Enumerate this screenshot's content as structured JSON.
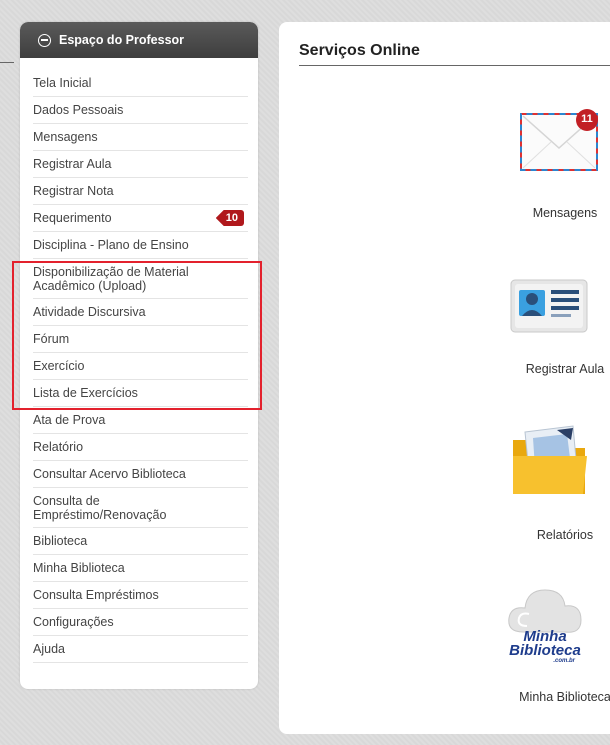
{
  "sidebar": {
    "title": "Espaço do Professor",
    "items": [
      {
        "label": "Tela Inicial"
      },
      {
        "label": "Dados Pessoais"
      },
      {
        "label": "Mensagens"
      },
      {
        "label": "Registrar Aula"
      },
      {
        "label": "Registrar Nota"
      },
      {
        "label": "Requerimento",
        "badge": "10"
      },
      {
        "label": "Disciplina - Plano de Ensino"
      },
      {
        "label": "Disponibilização de Material Acadêmico (Upload)"
      },
      {
        "label": "Atividade Discursiva"
      },
      {
        "label": "Fórum"
      },
      {
        "label": "Exercício"
      },
      {
        "label": "Lista de Exercícios"
      },
      {
        "label": "Ata de Prova"
      },
      {
        "label": "Relatório"
      },
      {
        "label": "Consultar Acervo Biblioteca"
      },
      {
        "label": "Consulta de Empréstimo/Renovação"
      },
      {
        "label": "Biblioteca"
      },
      {
        "label": "Minha Biblioteca"
      },
      {
        "label": "Consulta Empréstimos"
      },
      {
        "label": "Configurações"
      },
      {
        "label": "Ajuda"
      }
    ]
  },
  "main": {
    "title": "Serviços Online",
    "services": [
      {
        "label": "Mensagens",
        "icon": "envelope-icon",
        "badge": "11"
      },
      {
        "label": "Registrar Aula",
        "icon": "id-card-icon"
      },
      {
        "label": "Relatórios",
        "icon": "folder-icon"
      },
      {
        "label": "Minha Biblioteca",
        "icon": "cloud-library-icon",
        "logo_line1": "Minha",
        "logo_line2": "Biblioteca",
        "logo_small": ".com.br"
      }
    ]
  },
  "colors": {
    "accent_red": "#e3212d",
    "badge_red": "#b0181c",
    "header_dark": "#474747",
    "library_blue": "#1e3c8c"
  }
}
